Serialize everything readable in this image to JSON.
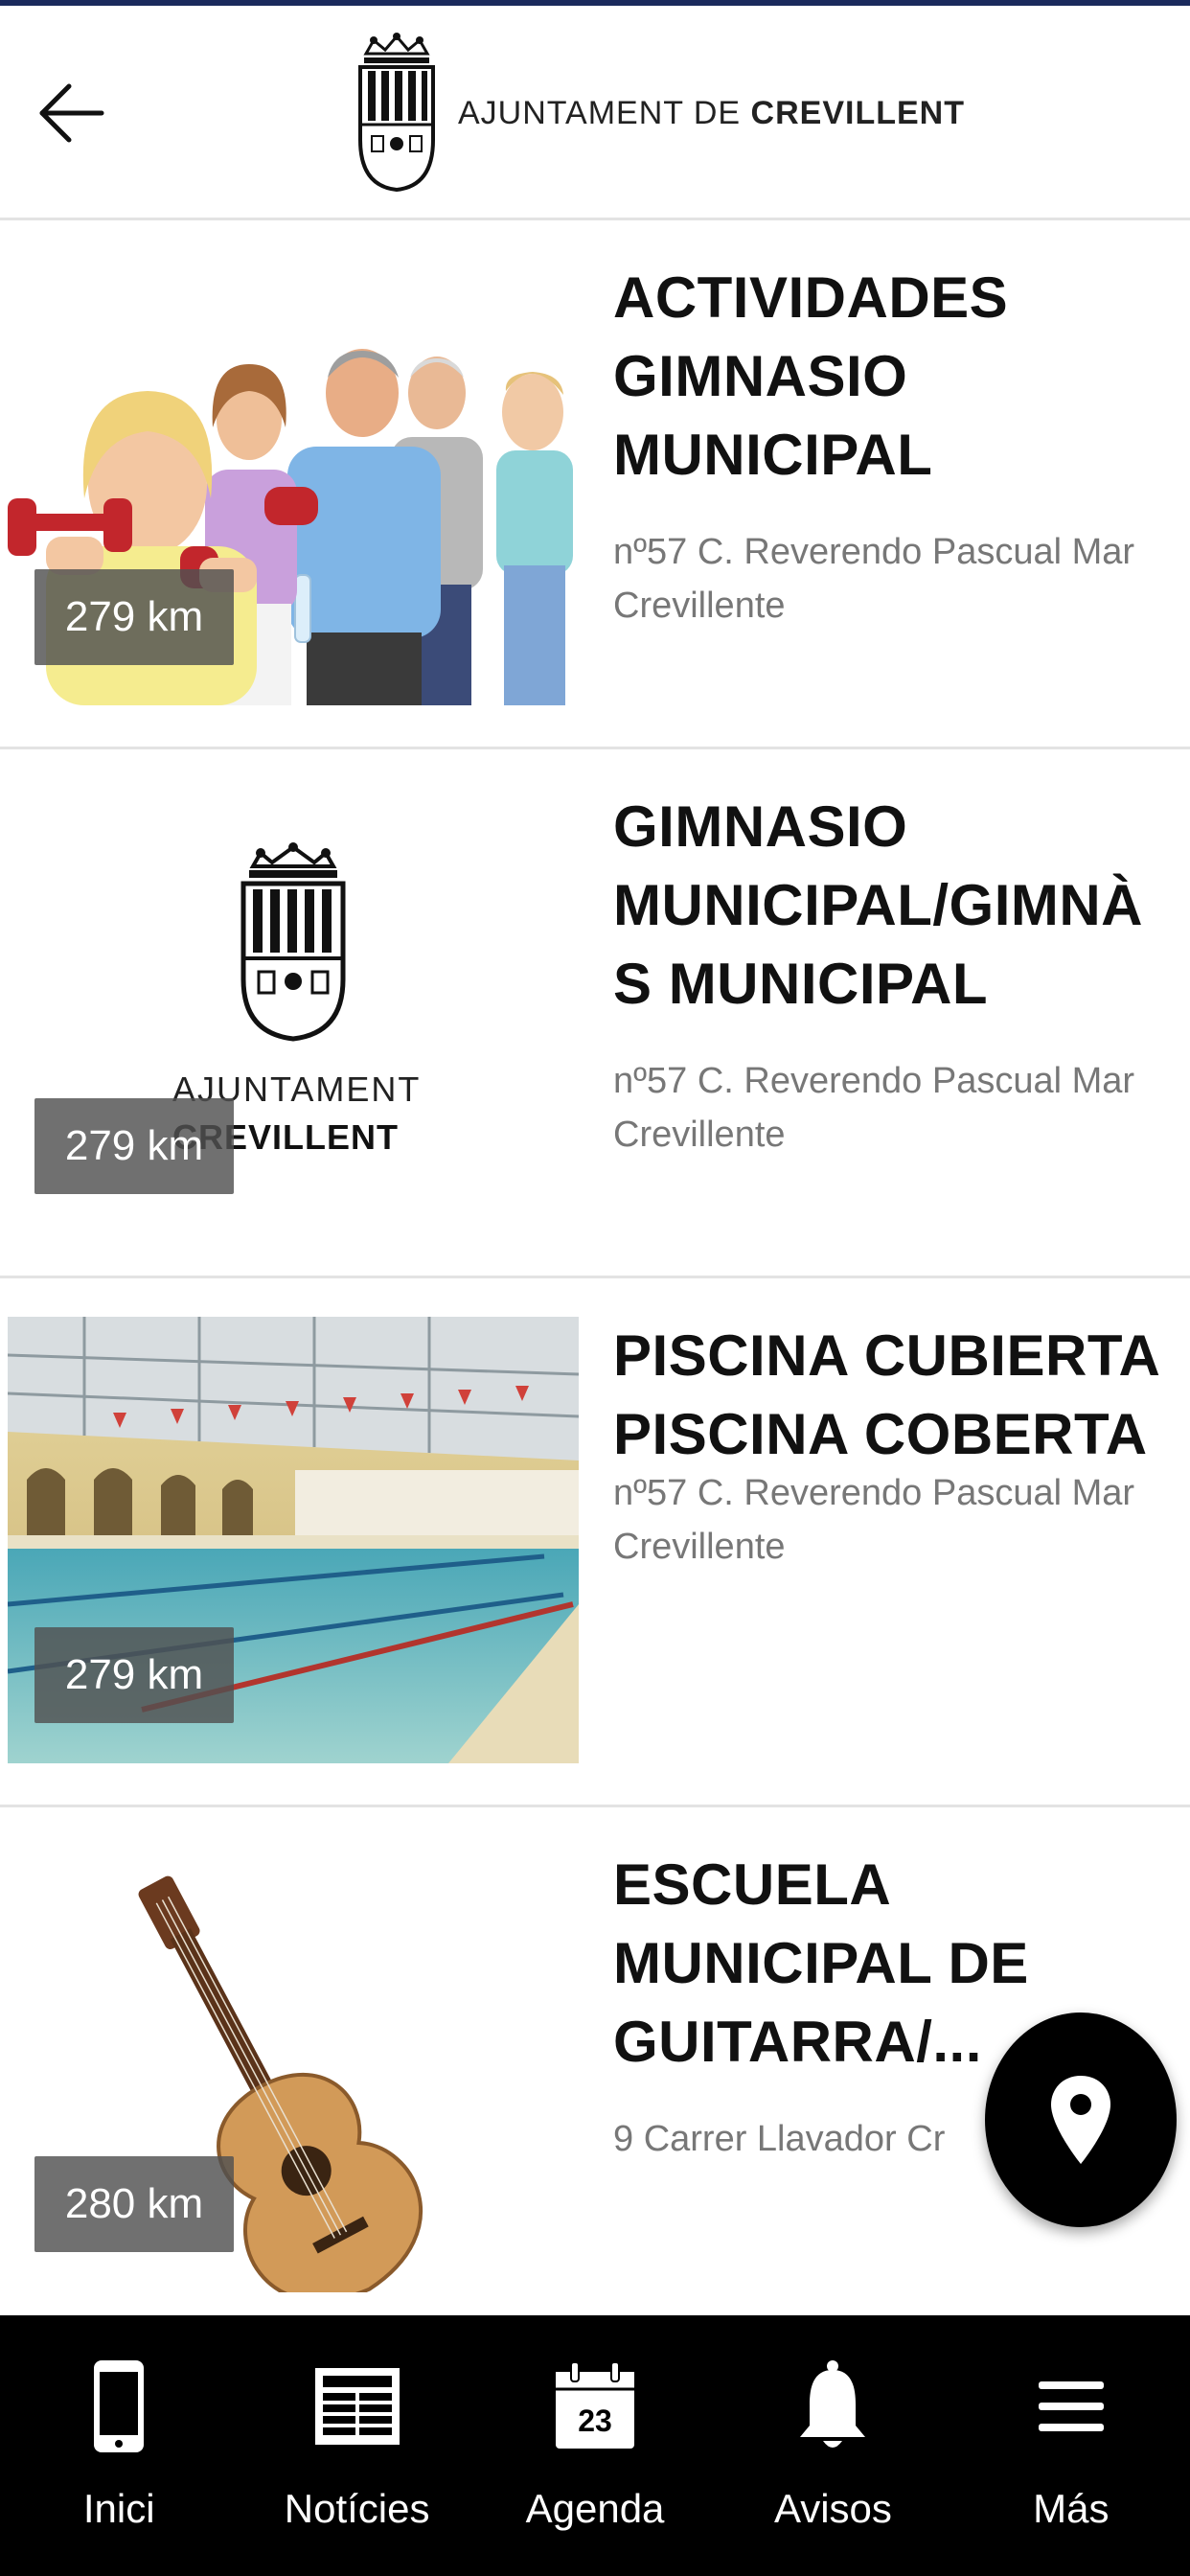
{
  "header": {
    "logo_text_light": "AJUNTAMENT DE ",
    "logo_text_bold": "CREVILLENT"
  },
  "items": [
    {
      "title": "ACTIVIDADES\nGIMNASIO\nMUNICIPAL",
      "address": "nº57 C. Reverendo Pascual Mar\nCrevillente",
      "distance": "279 km",
      "image": "people-with-dumbbells-photo"
    },
    {
      "title": "GIMNASIO\nMUNICIPAL/GIMNÀ\nS MUNICIPAL",
      "address": "nº57 C. Reverendo Pascual Mar\nCrevillente",
      "distance": "279 km",
      "image": "ajuntament-logo",
      "image_text_1": "AJUNTAMENT",
      "image_text_2": "CREVILLENT"
    },
    {
      "title": "PISCINA CUBIERTA\nPISCINA COBERTA",
      "address": "nº57 C. Reverendo Pascual Mar\nCrevillente",
      "distance": "279 km",
      "image": "indoor-pool-photo"
    },
    {
      "title": "ESCUELA\nMUNICIPAL DE\nGUITARRA/...",
      "address": "9 Carrer Llavador Cr",
      "distance": "280 km",
      "image": "guitar-photo"
    }
  ],
  "nav": [
    {
      "label": "Inici",
      "icon": "phone-icon"
    },
    {
      "label": "Notícies",
      "icon": "newspaper-icon"
    },
    {
      "label": "Agenda",
      "icon": "calendar-icon",
      "icon_text": "23"
    },
    {
      "label": "Avisos",
      "icon": "bell-icon"
    },
    {
      "label": "Más",
      "icon": "menu-icon"
    }
  ],
  "colors": {
    "accent": "#000000",
    "top_strip": "#1a2a5c",
    "divider": "#e3e3e3",
    "muted": "#777777"
  }
}
